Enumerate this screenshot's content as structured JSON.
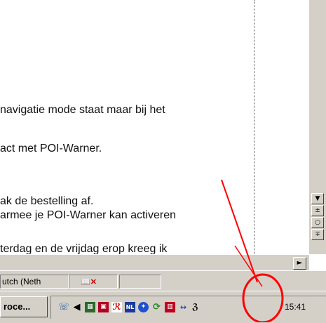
{
  "document": {
    "lines": [
      "navigatie mode staat maar bij het",
      "act met POI-Warner.",
      "ak de bestelling af.",
      "armee je POI-Warner kan activeren",
      "terdag en de vrijdag erop kreeg ik"
    ]
  },
  "status_bar": {
    "language": "utch (Neth",
    "spelling_icon": "spell-check-error-icon",
    "empty_panel": ""
  },
  "taskbar": {
    "active_window_label": "roce...",
    "tray_icons": [
      "phone-icon",
      "speaker-icon",
      "network-icon",
      "app-icon",
      "antivirus-icon",
      "language-nl-icon",
      "messenger-icon",
      "sync-icon",
      "shield-icon",
      "network-activity-icon",
      "connection-icon"
    ],
    "clock": "15:41"
  },
  "annotation": {
    "color": "#ff0000"
  }
}
